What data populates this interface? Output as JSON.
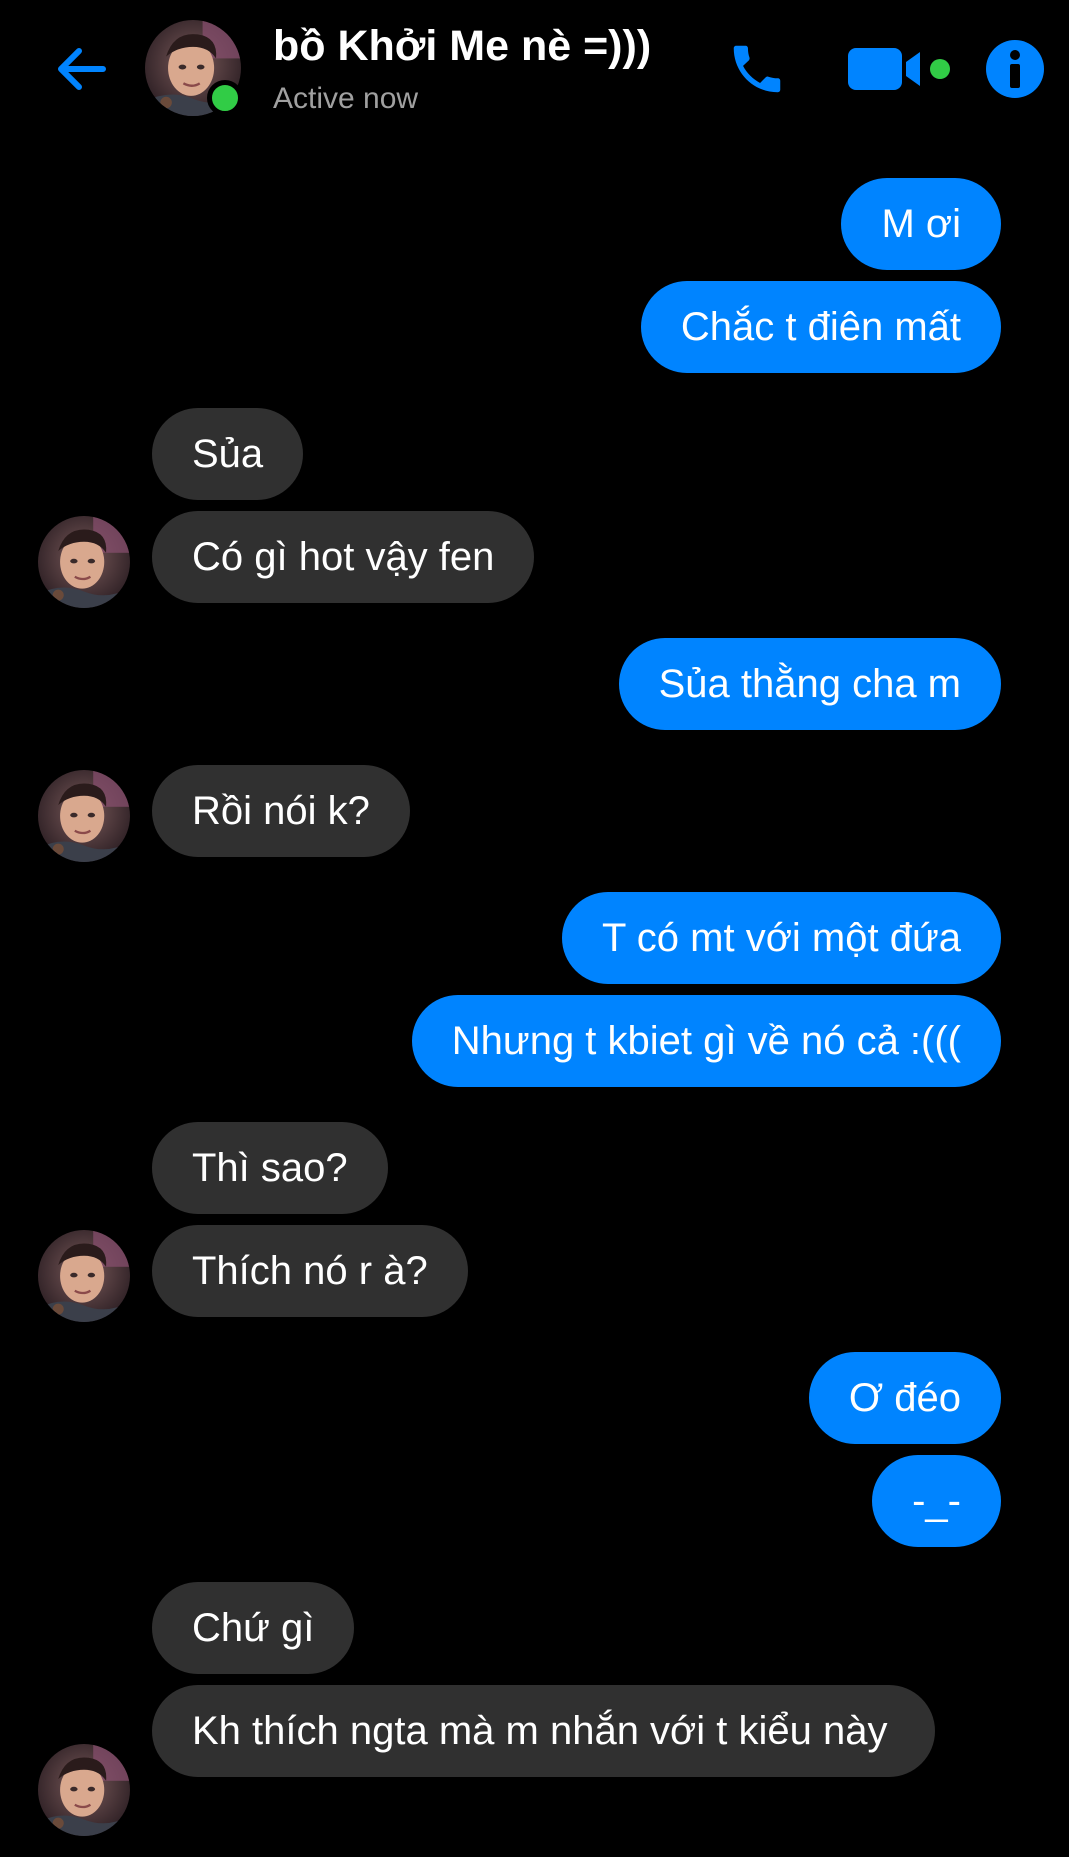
{
  "header": {
    "contact_name": "bồ Khởi Me nè =)))",
    "status": "Active now",
    "icons": {
      "back": "back-arrow-icon",
      "call": "phone-icon",
      "video": "video-camera-icon",
      "info": "info-icon"
    },
    "accent_color": "#0084ff",
    "online_color": "#31cc46"
  },
  "messages": [
    {
      "side": "out",
      "text": "M ơi"
    },
    {
      "side": "out",
      "text": "Chắc t điên mất"
    },
    {
      "side": "in",
      "text": "Sủa"
    },
    {
      "side": "in",
      "text": "Có gì hot vậy fen"
    },
    {
      "side": "out",
      "text": "Sủa thằng cha m"
    },
    {
      "side": "in",
      "text": "Rồi nói k?"
    },
    {
      "side": "out",
      "text": "T có mt với một đứa"
    },
    {
      "side": "out",
      "text": "Nhưng t kbiet gì về nó cả :((("
    },
    {
      "side": "in",
      "text": "Thì sao?"
    },
    {
      "side": "in",
      "text": "Thích nó r à?"
    },
    {
      "side": "out",
      "text": "Ơ đéo"
    },
    {
      "side": "out",
      "text": "-_-"
    },
    {
      "side": "in",
      "text": "Chứ gì"
    },
    {
      "side": "in",
      "text": "Kh thích ngta mà m nhắn với t kiểu này"
    }
  ],
  "colors": {
    "outgoing_bubble": "#0084ff",
    "incoming_bubble": "#303030",
    "background": "#000000"
  }
}
